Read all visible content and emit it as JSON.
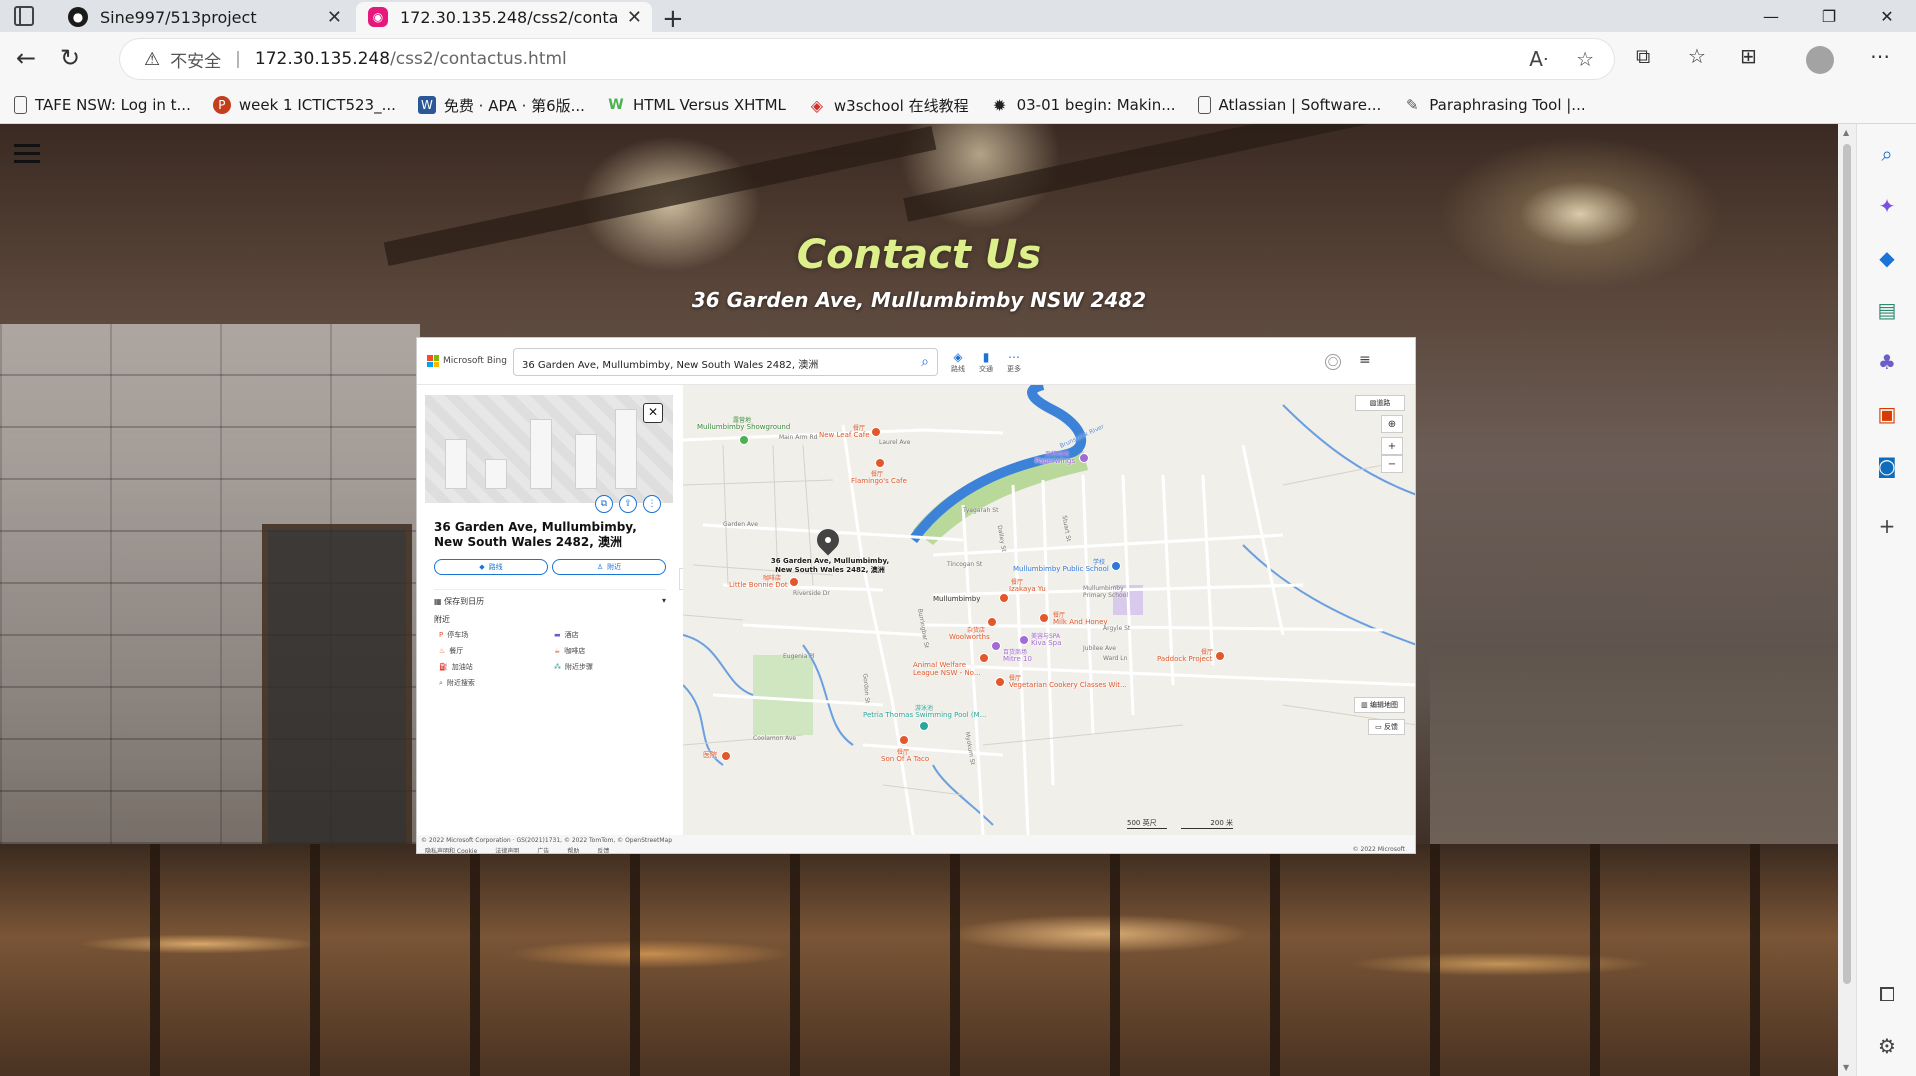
{
  "browser": {
    "tabs": [
      {
        "title": "Sine997/513project",
        "fav": "github-icon"
      },
      {
        "title": "172.30.135.248/css2/contactus.h",
        "fav": "site-icon"
      }
    ],
    "new_tab": "+",
    "url": {
      "insecure_label": "不安全",
      "host": "172.30.135.248",
      "path": "/css2/contactus.html"
    },
    "bookmarks": [
      {
        "label": "TAFE NSW: Log in t...",
        "icon": "page-icon",
        "color": "#ffffff"
      },
      {
        "label": "week 1 ICTICT523_...",
        "icon": "powerpoint-icon",
        "color": "#c43e1c"
      },
      {
        "label": "免费 · APA · 第6版...",
        "icon": "w-icon",
        "color": "#2b5797"
      },
      {
        "label": "HTML Versus XHTML",
        "icon": "w-green-icon",
        "color": "#4caf50"
      },
      {
        "label": "w3school 在线教程",
        "icon": "w3school-icon",
        "color": "#d32f2f"
      },
      {
        "label": "03-01 begin: Makin...",
        "icon": "gear-icon",
        "color": "#222222"
      },
      {
        "label": "Atlassian | Software...",
        "icon": "page-icon",
        "color": "#ffffff"
      },
      {
        "label": "Paraphrasing Tool |...",
        "icon": "quill-icon",
        "color": "#ffffff"
      }
    ]
  },
  "page": {
    "title": "Contact Us",
    "address": "36 Garden Ave, Mullumbimby NSW 2482"
  },
  "map": {
    "brand": "Microsoft Bing",
    "search_value": "36 Garden Ave, Mullumbimby, New South Wales 2482, 澳洲",
    "tools": [
      {
        "icon": "directions-icon",
        "label": "路线"
      },
      {
        "icon": "traffic-icon",
        "label": "交通"
      },
      {
        "icon": "more-icon",
        "label": "更多"
      }
    ],
    "place_name": "36 Garden Ave, Mullumbimby, New South Wales 2482, 澳洲",
    "buttons": {
      "directions": "路线",
      "nearby": "附近"
    },
    "save_calendar": "保存到日历",
    "nearby_title": "附近",
    "nearby_items": [
      {
        "label": "停车场",
        "icon": "parking-icon"
      },
      {
        "label": "酒店",
        "icon": "hotel-icon"
      },
      {
        "label": "餐厅",
        "icon": "restaurant-icon"
      },
      {
        "label": "咖啡店",
        "icon": "coffee-icon"
      },
      {
        "label": "加油站",
        "icon": "gas-icon"
      },
      {
        "label": "附近步骤",
        "icon": "steps-icon"
      },
      {
        "label": "附近搜索",
        "icon": "search-icon"
      }
    ],
    "map_type": "道路",
    "open_map": "编辑地图",
    "feedback": "反馈",
    "pin_label": "36 Garden Ave, Mullumbimby,\nNew South Wales 2482, 澳洲",
    "town_label": "Mullumbimby",
    "pois": [
      {
        "cat": "露营地",
        "name": "Mullumbimby Showground",
        "color": "#4caf50"
      },
      {
        "cat": "餐厅",
        "name": "New Leaf Cafe",
        "color": "#e2572b"
      },
      {
        "cat": "餐厅",
        "name": "Flamingo's Cafe",
        "color": "#e2572b"
      },
      {
        "cat": "百货商场",
        "name": "Paperwings",
        "color": "#a26bd6"
      },
      {
        "cat": "学校",
        "name": "Mullumbimby Public School",
        "color": "#2f78d8"
      },
      {
        "cat": "咖啡店",
        "name": "Little Bonnie Dot",
        "color": "#e2572b"
      },
      {
        "cat": "餐厅",
        "name": "Izakaya Yu",
        "color": "#e2572b"
      },
      {
        "cat": "餐厅",
        "name": "Milk And Honey",
        "color": "#e2572b"
      },
      {
        "cat": "杂货店",
        "name": "Woolworths",
        "color": "#e2572b"
      },
      {
        "cat": "美容与SPA",
        "name": "Kiva Spa",
        "color": "#a26bd6"
      },
      {
        "cat": "百货商场",
        "name": "Mitre 10",
        "color": "#a26bd6"
      },
      {
        "cat": "",
        "name": "Animal Welfare League NSW - No...",
        "color": "#e2572b"
      },
      {
        "cat": "餐厅",
        "name": "Vegetarian Cookery Classes Wit...",
        "color": "#e2572b"
      },
      {
        "cat": "餐厅",
        "name": "Paddock Project",
        "color": "#e2572b"
      },
      {
        "cat": "游泳池",
        "name": "Petria Thomas Swimming Pool (M...",
        "color": "#2aa79b"
      },
      {
        "cat": "餐厅",
        "name": "Son Of A Taco",
        "color": "#e2572b"
      },
      {
        "cat": "",
        "name": "医院",
        "color": "#e2572b"
      }
    ],
    "streets": [
      "Main Arm Rd",
      "Laurel Ave",
      "Brunswick River",
      "Tyagarah St",
      "Garden Ave",
      "Riverside Dr",
      "Dalley St",
      "Stuart St",
      "Argyle St",
      "Jubilee Ave",
      "Tincogan St",
      "Burringbar St",
      "Eugenia Pl",
      "Gordon St",
      "Coolamon Ave",
      "Myokum St",
      "Ward Ln",
      "Mullumbimby Primary School"
    ],
    "scale": [
      "500 英尺",
      "200 米"
    ],
    "copyright": "© 2022 Microsoft Corporation · GS(2021)1731, © 2022 TomTom, © OpenStreetMap",
    "footer_links": [
      "隐私声明和 Cookie",
      "法律声明",
      "广告",
      "帮助",
      "反馈"
    ],
    "footer_right": "© 2022 Microsoft"
  }
}
